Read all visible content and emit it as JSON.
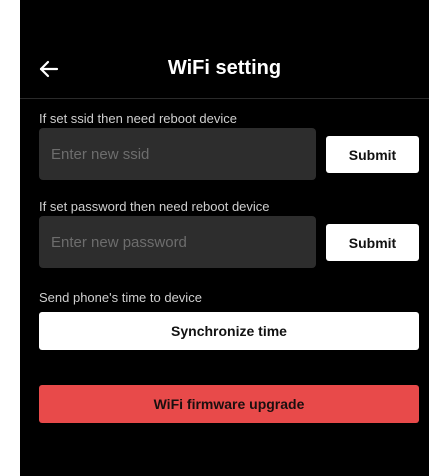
{
  "header": {
    "title": "WiFi setting",
    "back_icon": "arrow-left-icon"
  },
  "ssid_section": {
    "hint": "If set ssid then need reboot device",
    "placeholder": "Enter new ssid",
    "value": "",
    "submit_label": "Submit"
  },
  "password_section": {
    "hint": "If set password then need reboot device",
    "placeholder": "Enter new password",
    "value": "",
    "submit_label": "Submit"
  },
  "time_section": {
    "hint": "Send phone's time to device",
    "button_label": "Synchronize time"
  },
  "upgrade": {
    "button_label": "WiFi firmware upgrade"
  },
  "colors": {
    "background": "#000000",
    "input_background": "#2d2d2d",
    "button_white": "#ffffff",
    "upgrade_red": "#e84a4a"
  }
}
